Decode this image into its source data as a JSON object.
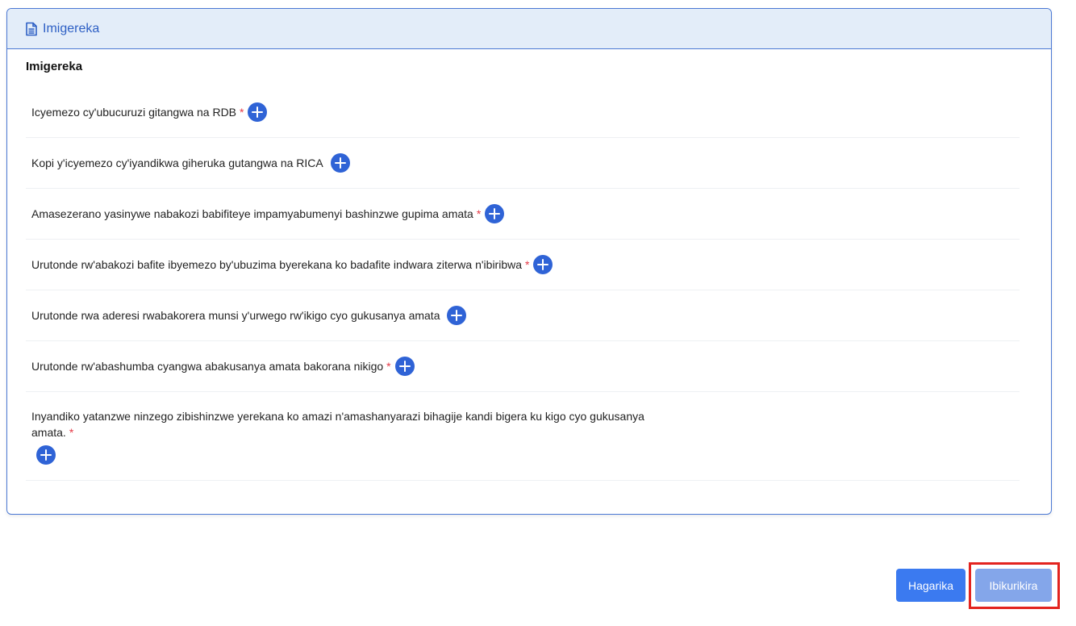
{
  "card": {
    "header_title": "Imigereka",
    "section_title": "Imigereka"
  },
  "documents": [
    {
      "label": "Icyemezo cy'ubucuruzi gitangwa na RDB",
      "required": "*"
    },
    {
      "label": "Kopi y'icyemezo cy'iyandikwa giheruka gutangwa na RICA",
      "required": ""
    },
    {
      "label": "Amasezerano yasinywe nabakozi babifiteye impamyabumenyi bashinzwe gupima amata",
      "required": "*"
    },
    {
      "label": "Urutonde rw'abakozi bafite ibyemezo by'ubuzima byerekana ko badafite indwara ziterwa n'ibiribwa",
      "required": "*"
    },
    {
      "label": "Urutonde rwa aderesi rwabakorera munsi y'urwego rw'ikigo cyo gukusanya amata",
      "required": ""
    },
    {
      "label": "Urutonde rw'abashumba cyangwa abakusanya amata bakorana nikigo",
      "required": "*"
    },
    {
      "label": "Inyandiko yatanzwe ninzego zibishinzwe yerekana ko amazi n'amashanyarazi bihagije kandi bigera ku kigo cyo gukusanya amata.",
      "required": "*"
    }
  ],
  "actions": {
    "cancel_label": "Hagarika",
    "submit_label": "Ibikurikira"
  },
  "icons": {
    "header": "file-text-icon",
    "add": "plus-circle-icon"
  },
  "colors": {
    "accent": "#2f63d6",
    "header_bg": "#e3edf9",
    "required": "#e53946",
    "cancel_button": "#3b7af0",
    "submit_button": "#84a6ea",
    "highlight": "#e3241f"
  }
}
